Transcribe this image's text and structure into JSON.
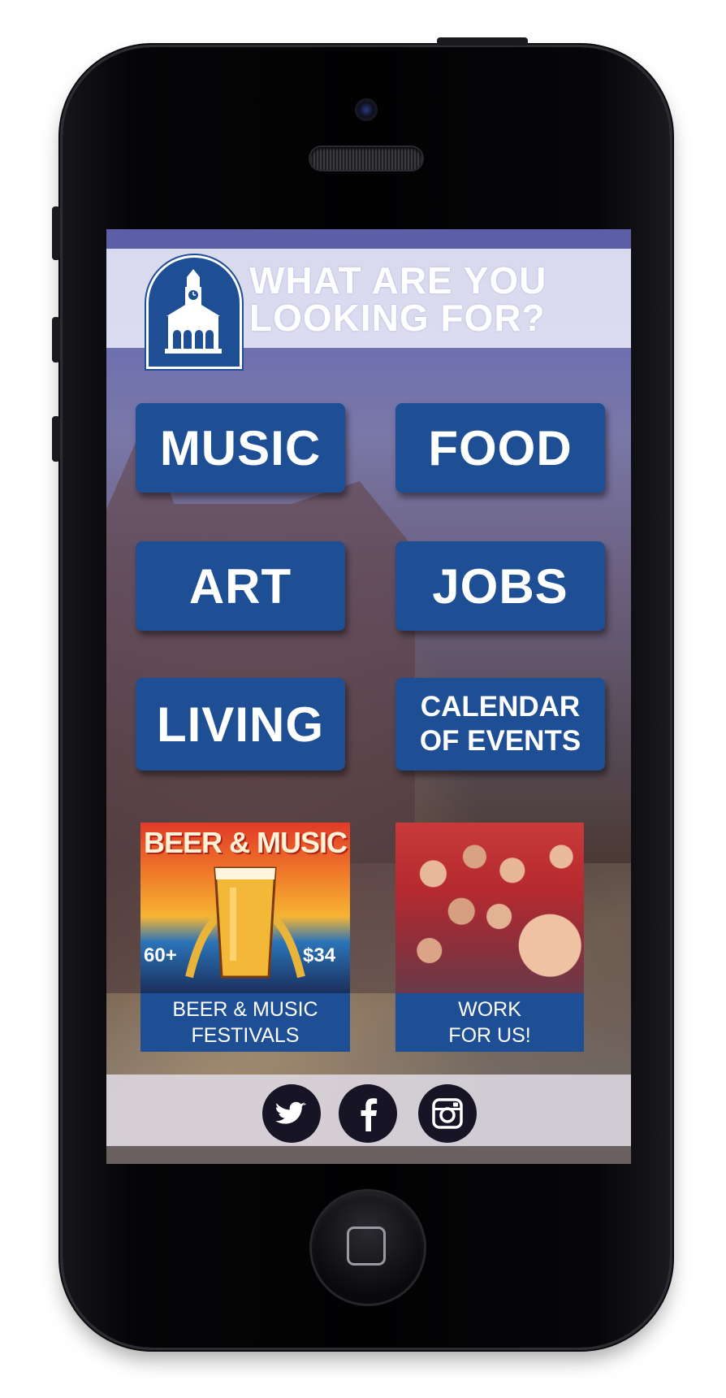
{
  "header": {
    "line1": "WHAT ARE YOU",
    "line2": "LOOKING FOR?"
  },
  "menu": {
    "music": "MUSIC",
    "food": "FOOD",
    "art": "ART",
    "jobs": "JOBS",
    "living": "LIVING",
    "calendar_line1": "CALENDAR",
    "calendar_line2": "OF EVENTS"
  },
  "promos": {
    "beer": {
      "poster_title": "BEER & MUSIC",
      "left_stat": "60+",
      "right_stat": "$34",
      "caption_line1": "BEER & MUSIC",
      "caption_line2": "FESTIVALS"
    },
    "work": {
      "caption_line1": "WORK",
      "caption_line2": "FOR US!"
    }
  },
  "social": {
    "twitter_icon": "twitter-icon",
    "facebook_icon": "facebook-icon",
    "instagram_icon": "instagram-icon"
  },
  "colors": {
    "brand_blue": "#1e4f95",
    "header_band": "#e4e4f4",
    "social_circle": "#171426"
  }
}
